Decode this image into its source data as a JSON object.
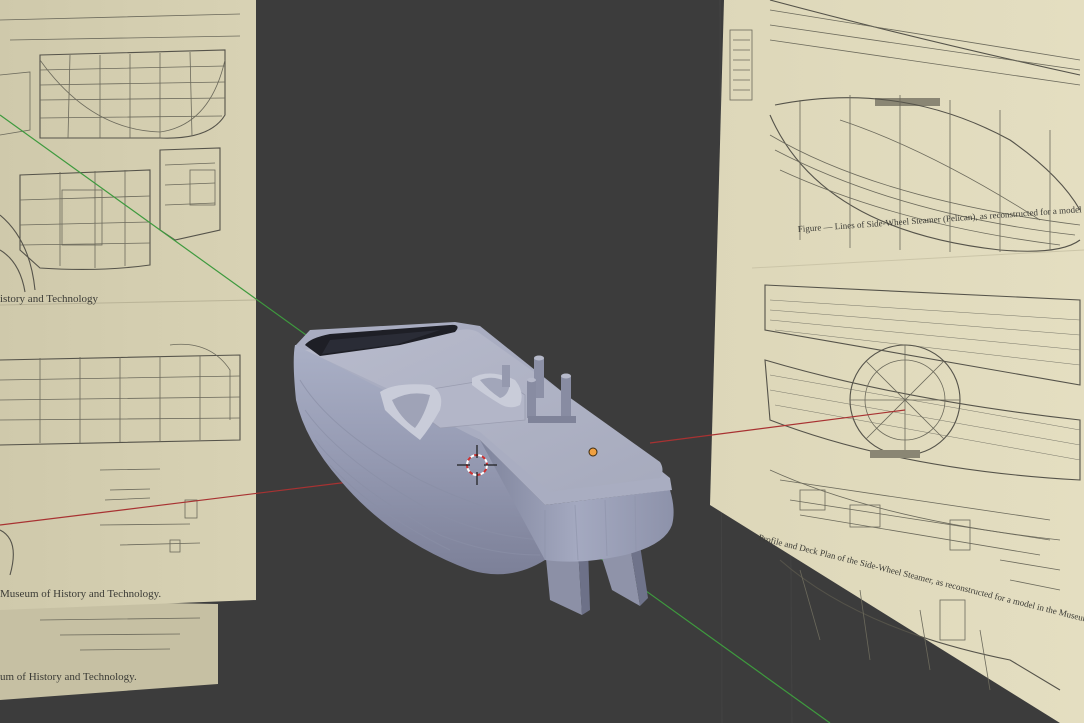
{
  "viewport": {
    "background": "#3c3c3c",
    "axis_x_color": "#a83232",
    "axis_y_color": "#3e9a3e",
    "grid_line_color": "#444444",
    "hull_color": "#9ba0b8",
    "origin_dot_color": "#f0a040",
    "blueprint_paper_color": "#dcd6b8"
  },
  "left_blueprint": {
    "caption_1": "istory and Technology",
    "caption_2": "Museum of History and Technology.",
    "caption_3": "um of History and Technology."
  },
  "right_blueprint": {
    "caption_1": "Figure — Lines of Side-Wheel Steamer (Pelican), as reconstructed for a model in the Museum of History and Technology.",
    "caption_2": "Profile and Deck Plan of the Side-Wheel Steamer, as reconstructed for a model in the Museum of History and Technology."
  },
  "scene": {
    "objects": [
      "blueprint-left",
      "blueprint-right",
      "ship-hull",
      "3d-cursor",
      "origin-point"
    ]
  }
}
